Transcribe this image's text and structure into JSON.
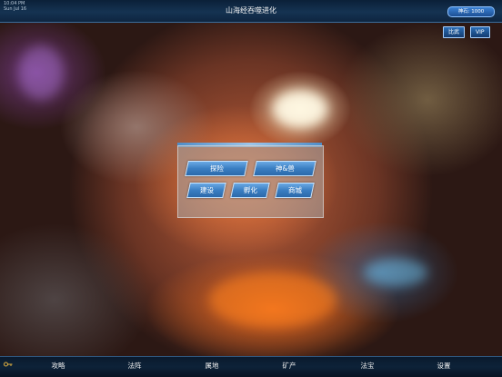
{
  "status_bar": {
    "time": "10:04 PM",
    "date": "Sun Jul 16"
  },
  "header": {
    "title": "山海经吞噬进化",
    "score_label": "神石: 1000"
  },
  "top_buttons": {
    "compete": "比武",
    "vip": "VIP"
  },
  "menu": {
    "explore": "探险",
    "beast": "神&兽",
    "build": "建设",
    "incubate": "孵化",
    "shop": "商城"
  },
  "nav": {
    "items": [
      {
        "label": "攻略"
      },
      {
        "label": "法阵"
      },
      {
        "label": "属地"
      },
      {
        "label": "矿产"
      },
      {
        "label": "法宝"
      },
      {
        "label": "设置"
      }
    ]
  },
  "colors": {
    "accent": "#3a7ec2",
    "bar": "#0d2238",
    "panel": "#aaaaaa"
  }
}
